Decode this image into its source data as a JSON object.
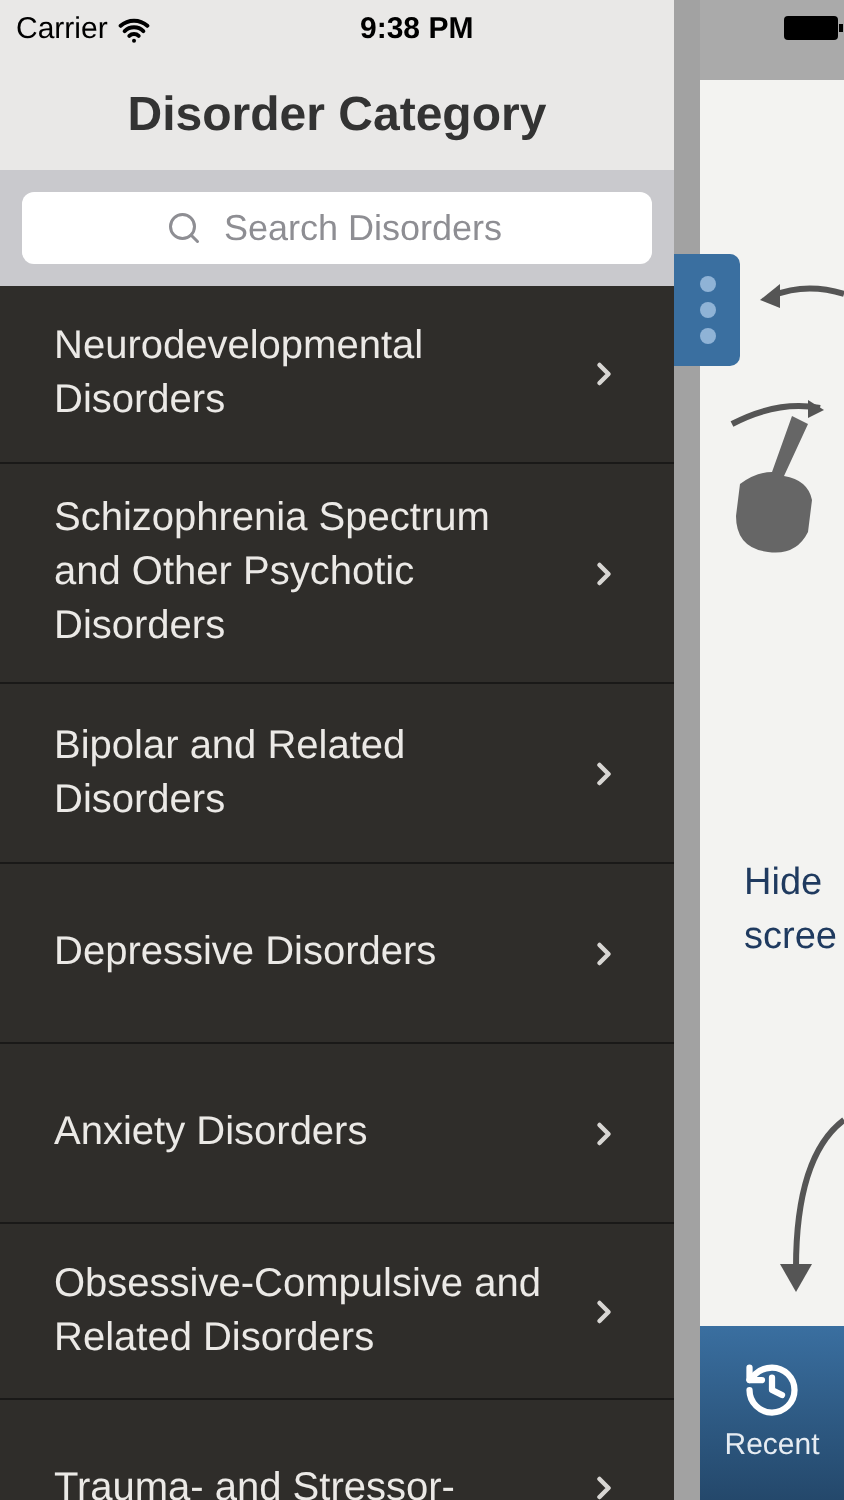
{
  "status_bar": {
    "carrier": "Carrier",
    "time": "9:38 PM"
  },
  "header": {
    "title": "Disorder Category"
  },
  "search": {
    "placeholder": "Search Disorders"
  },
  "categories": [
    {
      "label": "Neurodevelopmental Disorders"
    },
    {
      "label": "Schizophrenia Spectrum and Other Psychotic Disorders"
    },
    {
      "label": "Bipolar and Related Disorders"
    },
    {
      "label": "Depressive Disorders"
    },
    {
      "label": "Anxiety Disorders"
    },
    {
      "label": "Obsessive-Compulsive and Related Disorders"
    },
    {
      "label": "Trauma- and Stressor-"
    }
  ],
  "tutorial": {
    "lines": [
      "Hide",
      "scree"
    ]
  },
  "bottom_tab": {
    "label": "Recent"
  }
}
